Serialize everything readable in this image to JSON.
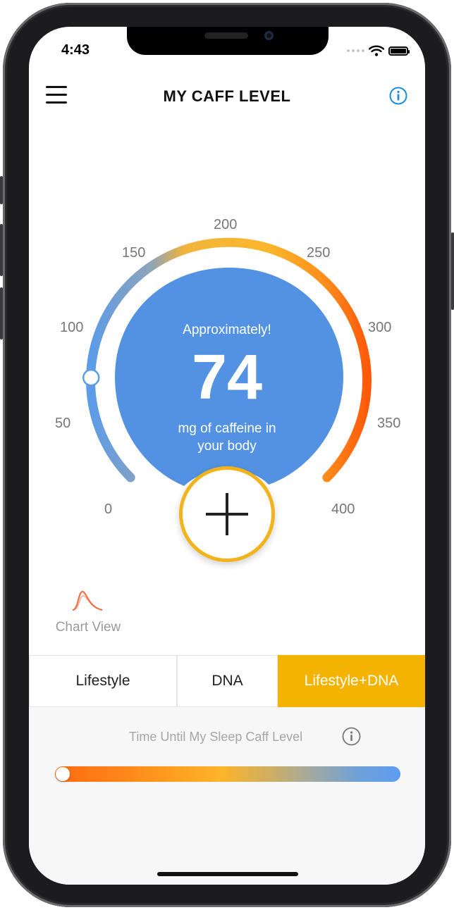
{
  "status_bar": {
    "time": "4:43"
  },
  "header": {
    "title": "MY CAFF LEVEL",
    "menu_icon": "hamburger-menu-icon",
    "info_icon": "info-circle-icon"
  },
  "gauge": {
    "tick_labels": [
      "0",
      "50",
      "100",
      "150",
      "200",
      "250",
      "300",
      "350",
      "400"
    ],
    "approx_label": "Approximately!",
    "value": "74",
    "unit_line1": "mg of caffeine in",
    "unit_line2": "your body",
    "min": 0,
    "max": 400,
    "current_mg": 74,
    "colors": {
      "low": "#5c9ce8",
      "mid": "#fbb62b",
      "high": "#ff5a09",
      "disc": "#5392e2"
    }
  },
  "add_button": {
    "icon": "plus-icon"
  },
  "chart_view": {
    "label": "Chart View",
    "icon": "curve-chart-icon"
  },
  "tabs": [
    {
      "label": "Lifestyle",
      "active": false
    },
    {
      "label": "DNA",
      "active": false
    },
    {
      "label": "Lifestyle+DNA",
      "active": true
    }
  ],
  "sleep": {
    "label": "Time Until My Sleep Caff Level",
    "info_icon": "info-circle-icon",
    "progress": 0
  },
  "accent_color": "#f4b301"
}
